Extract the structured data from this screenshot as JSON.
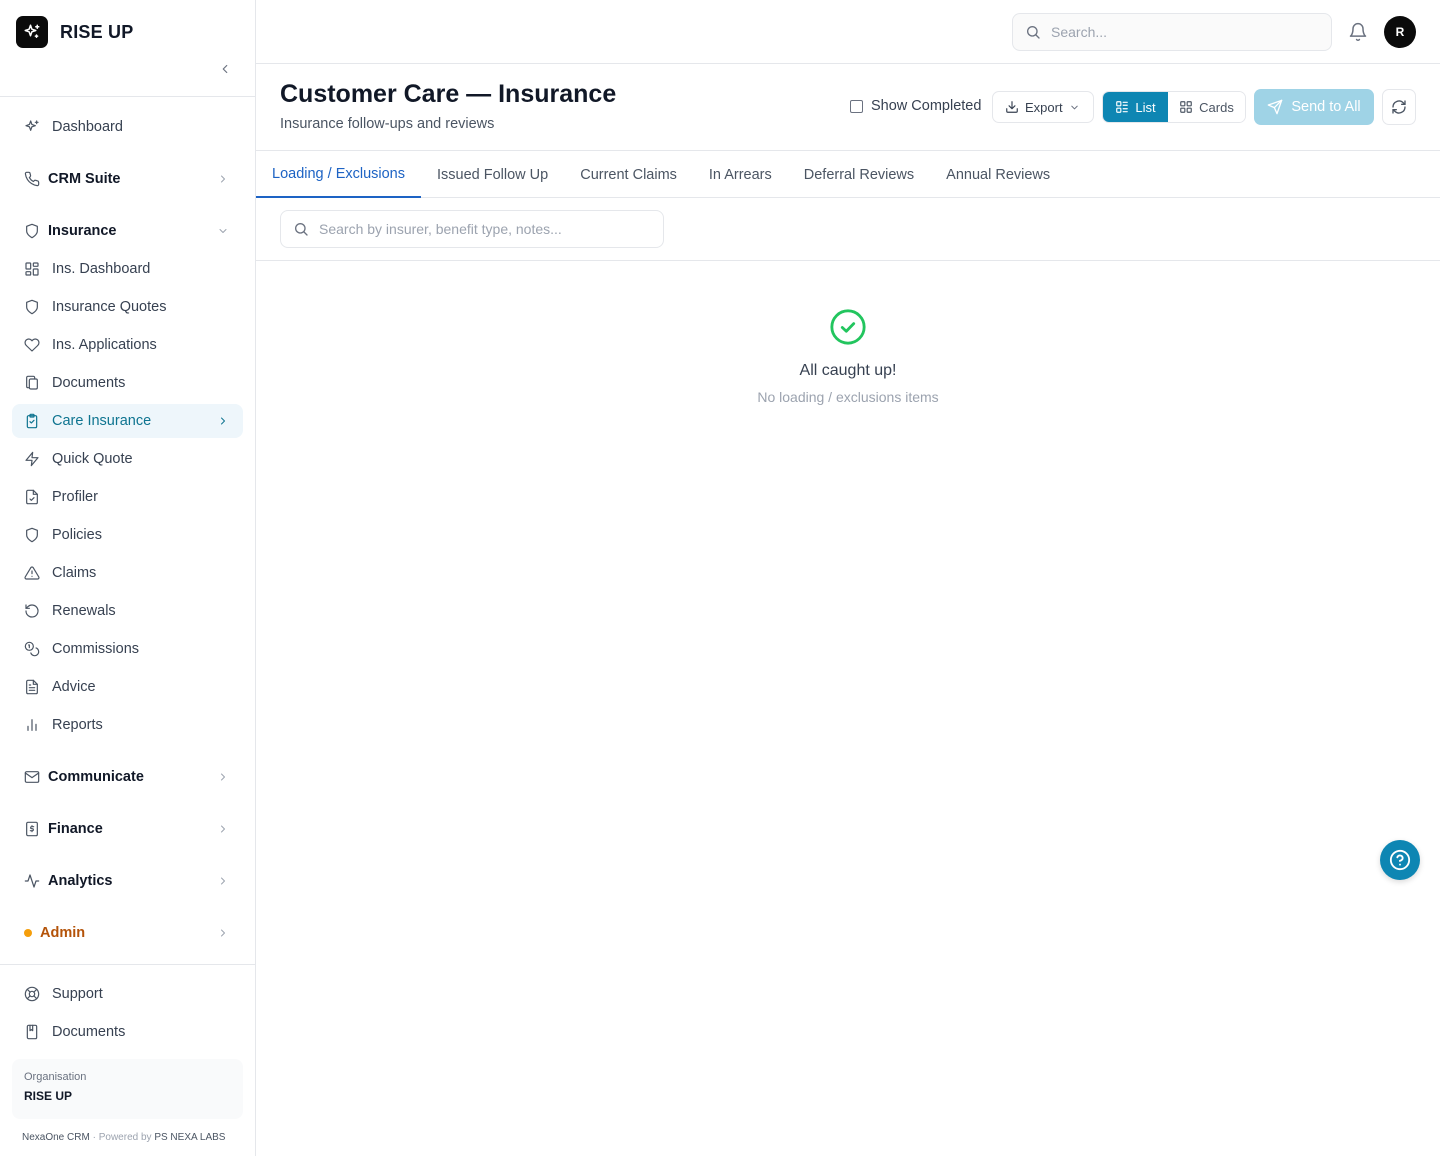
{
  "brand": {
    "name": "RISE UP"
  },
  "topbar": {
    "search_placeholder": "Search...",
    "avatar_initial": "R"
  },
  "sidebar": {
    "dashboard": "Dashboard",
    "crm_suite": "CRM Suite",
    "insurance": "Insurance",
    "insurance_items": [
      "Ins. Dashboard",
      "Insurance Quotes",
      "Ins. Applications",
      "Documents",
      "Care Insurance",
      "Quick Quote",
      "Profiler",
      "Policies",
      "Claims",
      "Renewals",
      "Commissions",
      "Advice",
      "Reports"
    ],
    "communicate": "Communicate",
    "finance": "Finance",
    "analytics": "Analytics",
    "admin": "Admin",
    "support": "Support",
    "documents_bottom": "Documents",
    "org_label": "Organisation",
    "org_name": "RISE UP",
    "footer_app": "NexaOne CRM",
    "footer_sep": "·",
    "footer_powered": "Powered by",
    "footer_company": "PS NEXA LABS"
  },
  "header": {
    "title": "Customer Care — Insurance",
    "subtitle": "Insurance follow-ups and reviews",
    "show_completed": "Show Completed",
    "export": "Export",
    "list": "List",
    "cards": "Cards",
    "send_to_all": "Send to All"
  },
  "tabs": [
    "Loading / Exclusions",
    "Issued Follow Up",
    "Current Claims",
    "In Arrears",
    "Deferral Reviews",
    "Annual Reviews"
  ],
  "tab_search_placeholder": "Search by insurer, benefit type, notes...",
  "empty_state": {
    "title": "All caught up!",
    "subtitle": "No loading / exclusions items"
  },
  "colors": {
    "accent": "#0e86b3",
    "tab_active": "#1d63c4",
    "success": "#22c55e",
    "admin": "#f59e0b"
  }
}
